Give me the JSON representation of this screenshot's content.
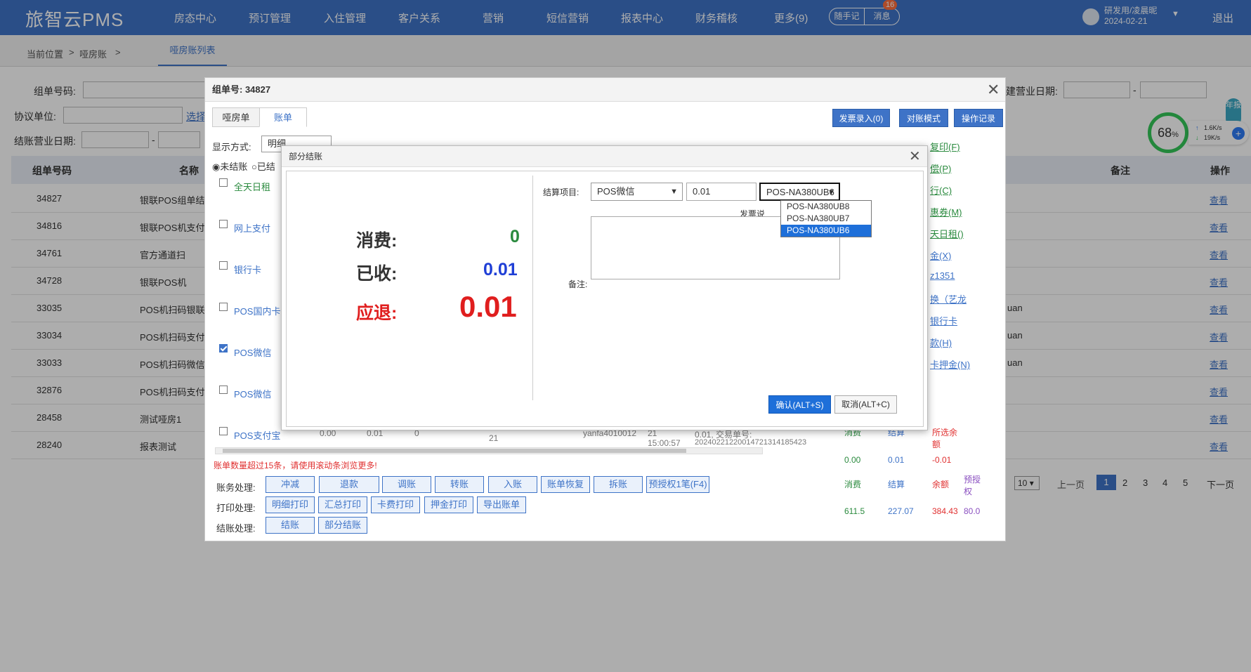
{
  "app": {
    "logo": "旅智云PMS"
  },
  "nav": [
    "房态中心",
    "预订管理",
    "入住管理",
    "客户关系",
    "营销",
    "短信营销",
    "报表中心",
    "财务稽核",
    "更多(9)"
  ],
  "topbar": {
    "memo": "随手记",
    "message": "消息",
    "message_count": "16",
    "user": "研发用/凌晨昵",
    "date": "2024-02-21",
    "logout": "退出"
  },
  "breadcrumb": {
    "current": "当前位置",
    "arrow1": ">",
    "page": "哑房账",
    "arrow2": ">",
    "tab": "哑房账列表"
  },
  "filters": {
    "group_no": "组单号码:",
    "agreement": "协议单位:",
    "select": "选择",
    "settle_date": "结账营业日期:",
    "dash": "-",
    "biz_date": "建营业日期:"
  },
  "table": {
    "headers": [
      "组单号码",
      "名称",
      "备注",
      "操作"
    ],
    "rows": [
      {
        "id": "34827",
        "name": "银联POS组单结",
        "extra": "",
        "op": "查看"
      },
      {
        "id": "34816",
        "name": "银联POS机支付",
        "extra": "",
        "op": "查看"
      },
      {
        "id": "34761",
        "name": "官方通道扫",
        "extra": "",
        "op": "查看"
      },
      {
        "id": "34728",
        "name": "银联POS机",
        "extra": "",
        "op": "查看"
      },
      {
        "id": "33035",
        "name": "POS机扫码银联二",
        "extra": "uan",
        "op": "查看"
      },
      {
        "id": "33034",
        "name": "POS机扫码支付",
        "extra": "uan",
        "op": "查看"
      },
      {
        "id": "33033",
        "name": "POS机扫码微信",
        "extra": "uan",
        "op": "查看"
      },
      {
        "id": "32876",
        "name": "POS机扫码支付",
        "extra": "",
        "op": "查看"
      },
      {
        "id": "28458",
        "name": "测试哑房1",
        "extra": "",
        "op": "查看"
      },
      {
        "id": "28240",
        "name": "报表测试",
        "extra": "",
        "op": "查看"
      }
    ],
    "pager": {
      "size": "10",
      "prev": "上一页",
      "pages": [
        "1",
        "2",
        "3",
        "4",
        "5"
      ],
      "next": "下一页"
    }
  },
  "window": {
    "title": "组单号: 34827",
    "tabs": [
      "哑房单",
      "账单"
    ],
    "display_mode": "显示方式:",
    "display_value": "明细",
    "radio1": "未结账",
    "radio2": "已结",
    "buttons": [
      "发票录入(0)",
      "对账模式",
      "操作记录"
    ],
    "items": [
      "全天日租",
      "网上支付",
      "银行卡",
      "POS国内卡刷",
      "POS微信",
      "POS微信",
      "POS支付宝"
    ],
    "right_links": [
      "复印(F)",
      "偿(P)",
      "行(C)",
      "惠券(M)",
      "天日租()",
      "金(X)",
      "z1351",
      "换（艺龙",
      "银行卡",
      "款(H)",
      "卡押金(N)"
    ],
    "partial_row": {
      "a": "0.00",
      "b": "0.01",
      "c": "0",
      "d": "21",
      "e": "yanfa4010012",
      "f": "21",
      "g": "15:00:57",
      "h": "0.01, 交易单号:",
      "i": "20240221220014721314185423"
    },
    "warning": "账单数量超过15条，请使用滚动条浏览更多!",
    "summary1": {
      "h1": "消费",
      "h2": "结算",
      "h3": "所选余额",
      "v1": "0.00",
      "v2": "0.01",
      "v3": "-0.01"
    },
    "summary2": {
      "h1": "消费",
      "h2": "结算",
      "h3": "余额",
      "h4": "预授权",
      "v1": "611.5",
      "v2": "227.07",
      "v3": "384.43",
      "v4": "80.0"
    },
    "actions": {
      "label": "账务处理:",
      "items": [
        "冲减",
        "退款",
        "调账",
        "转账",
        "入账",
        "账单恢复",
        "拆账",
        "预授权1笔(F4)"
      ]
    },
    "prints": {
      "label": "打印处理:",
      "items": [
        "明细打印",
        "汇总打印",
        "卡费打印",
        "押金打印",
        "导出账单"
      ]
    },
    "settle": {
      "label": "结账处理:",
      "items": [
        "结账",
        "部分结账"
      ]
    }
  },
  "dialog": {
    "title": "部分结账",
    "consume_label": "消费:",
    "consume_value": "0",
    "received_label": "已收:",
    "received_value": "0.01",
    "refund_label": "应退:",
    "refund_value": "0.01",
    "settle_item_label": "结算项目:",
    "settle_item_value": "POS微信",
    "amount": "0.01",
    "device_value": "POS-NA380UB6",
    "device_options": [
      "POS-NA380UB8",
      "POS-NA380UB7",
      "POS-NA380UB6"
    ],
    "invoice_hint": "发票说",
    "remark_label": "备注:",
    "ok": "确认(ALT+S)",
    "cancel": "取消(ALT+C)"
  },
  "widget": {
    "percent": "68",
    "pct_sign": "%",
    "up": "1.6K/s",
    "down": "19K/s",
    "side": "年报"
  }
}
